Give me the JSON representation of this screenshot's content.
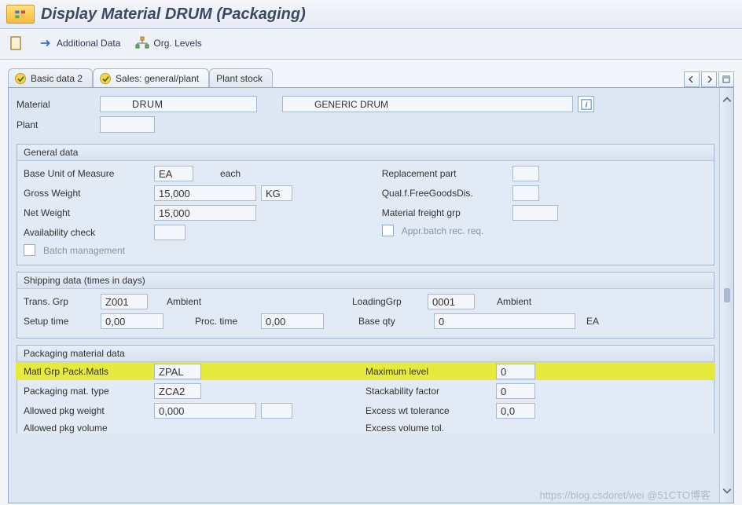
{
  "header": {
    "title": "Display Material        DRUM (Packaging)"
  },
  "toolbar": {
    "additional_data": "Additional Data",
    "org_levels": "Org. Levels"
  },
  "tabs": {
    "basic2": "Basic data 2",
    "sales_gen": "Sales: general/plant",
    "plant_stock": "Plant stock"
  },
  "material": {
    "label": "Material",
    "value": "DRUM",
    "desc": "GENERIC DRUM",
    "plant_label": "Plant",
    "plant_value": ""
  },
  "general": {
    "title": "General data",
    "buom_lbl": "Base Unit of Measure",
    "buom": "EA",
    "buom_txt": "each",
    "gross_lbl": "Gross Weight",
    "gross": "15,000",
    "gross_u": "KG",
    "net_lbl": "Net Weight",
    "net": "15,000",
    "avail_lbl": "Availability check",
    "avail": "",
    "batch_lbl": "Batch management",
    "repl_lbl": "Replacement part",
    "qual_lbl": "Qual.f.FreeGoodsDis.",
    "freight_lbl": "Material freight grp",
    "appr_lbl": "Appr.batch rec. req."
  },
  "shipping": {
    "title": "Shipping data (times in days)",
    "trans_lbl": "Trans. Grp",
    "trans": "Z001",
    "trans_txt": "Ambient",
    "load_lbl": "LoadingGrp",
    "load": "0001",
    "load_txt": "Ambient",
    "setup_lbl": "Setup time",
    "setup": "0,00",
    "proc_lbl": "Proc. time",
    "proc": "0,00",
    "base_lbl": "Base qty",
    "base": "0",
    "base_u": "EA"
  },
  "packaging": {
    "title": "Packaging material data",
    "matl_grp_lbl": "Matl Grp Pack.Matls",
    "matl_grp": "ZPAL",
    "pmt_lbl": "Packaging mat. type",
    "pmt": "ZCA2",
    "apw_lbl": "Allowed pkg weight",
    "apw": "0,000",
    "apv_lbl": "Allowed pkg volume",
    "max_lbl": "Maximum level",
    "max": "0",
    "stack_lbl": "Stackability factor",
    "stack": "0",
    "ewt_lbl": "Excess wt tolerance",
    "ewt": "0,0",
    "evt_lbl": "Excess volume tol."
  },
  "watermark": "https://blog.csdoret/wei @51CTO博客"
}
